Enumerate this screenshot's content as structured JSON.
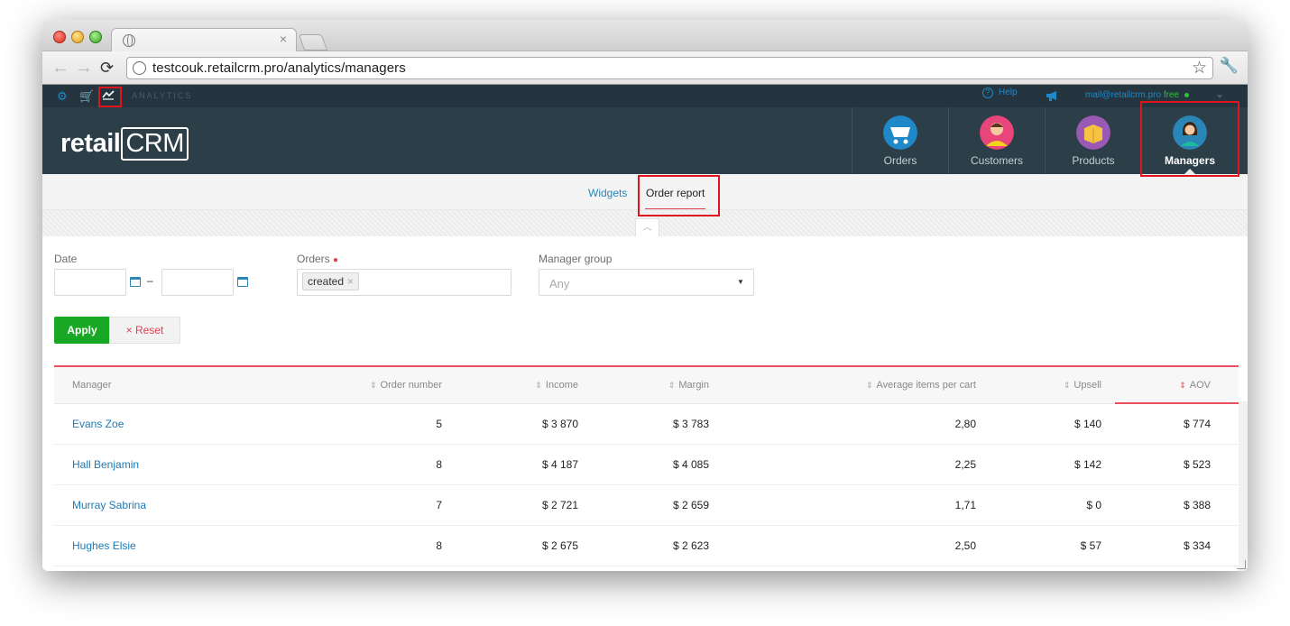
{
  "browser": {
    "url": "testcouk.retailcrm.pro/analytics/managers",
    "tab_close": "×"
  },
  "topbar": {
    "section_label": "ANALYTICS",
    "help": "Help",
    "email": "mail@retailcrm.pro",
    "plan": "free"
  },
  "header": {
    "logo_text": "retail",
    "logo_crm": "CRM",
    "nav": [
      {
        "label": "Orders"
      },
      {
        "label": "Customers"
      },
      {
        "label": "Products"
      },
      {
        "label": "Managers"
      }
    ],
    "active_nav": "Managers"
  },
  "subnav": {
    "widgets": "Widgets",
    "order_report": "Order report"
  },
  "filters": {
    "date_label": "Date",
    "date_separator": "–",
    "orders_label": "Orders",
    "orders_required": "●",
    "orders_chip": "created",
    "chip_remove": "×",
    "manager_group_label": "Manager group",
    "manager_group_value": "Any",
    "apply": "Apply",
    "reset": "Reset",
    "reset_icon": "×"
  },
  "table": {
    "columns": [
      "Manager",
      "Order number",
      "Income",
      "Margin",
      "Average items per cart",
      "Upsell",
      "AOV"
    ],
    "rows": [
      {
        "manager": "Evans Zoe",
        "orders": "5",
        "income": "$ 3 870",
        "margin": "$ 3 783",
        "avg_items": "2,80",
        "upsell": "$ 140",
        "aov": "$ 774"
      },
      {
        "manager": "Hall Benjamin",
        "orders": "8",
        "income": "$ 4 187",
        "margin": "$ 4 085",
        "avg_items": "2,25",
        "upsell": "$ 142",
        "aov": "$ 523"
      },
      {
        "manager": "Murray Sabrina",
        "orders": "7",
        "income": "$ 2 721",
        "margin": "$ 2 659",
        "avg_items": "1,71",
        "upsell": "$ 0",
        "aov": "$ 388"
      },
      {
        "manager": "Hughes Elsie",
        "orders": "8",
        "income": "$ 2 675",
        "margin": "$ 2 623",
        "avg_items": "2,50",
        "upsell": "$ 57",
        "aov": "$ 334"
      }
    ],
    "sorted_column": "AOV"
  },
  "icons": {
    "settings": "gear-icon",
    "cart": "cart-icon",
    "analytics": "chart-line-icon",
    "help": "question-circle-icon",
    "announcements": "megaphone-icon",
    "calendar": "calendar-icon",
    "sort": "sort-icon"
  },
  "colors": {
    "brand_dark": "#2c3e48",
    "topbar": "#24353f",
    "link": "#1d7ab5",
    "apply_green": "#18a824",
    "accent_red": "#e85060",
    "highlight_red": "#e0141c"
  }
}
